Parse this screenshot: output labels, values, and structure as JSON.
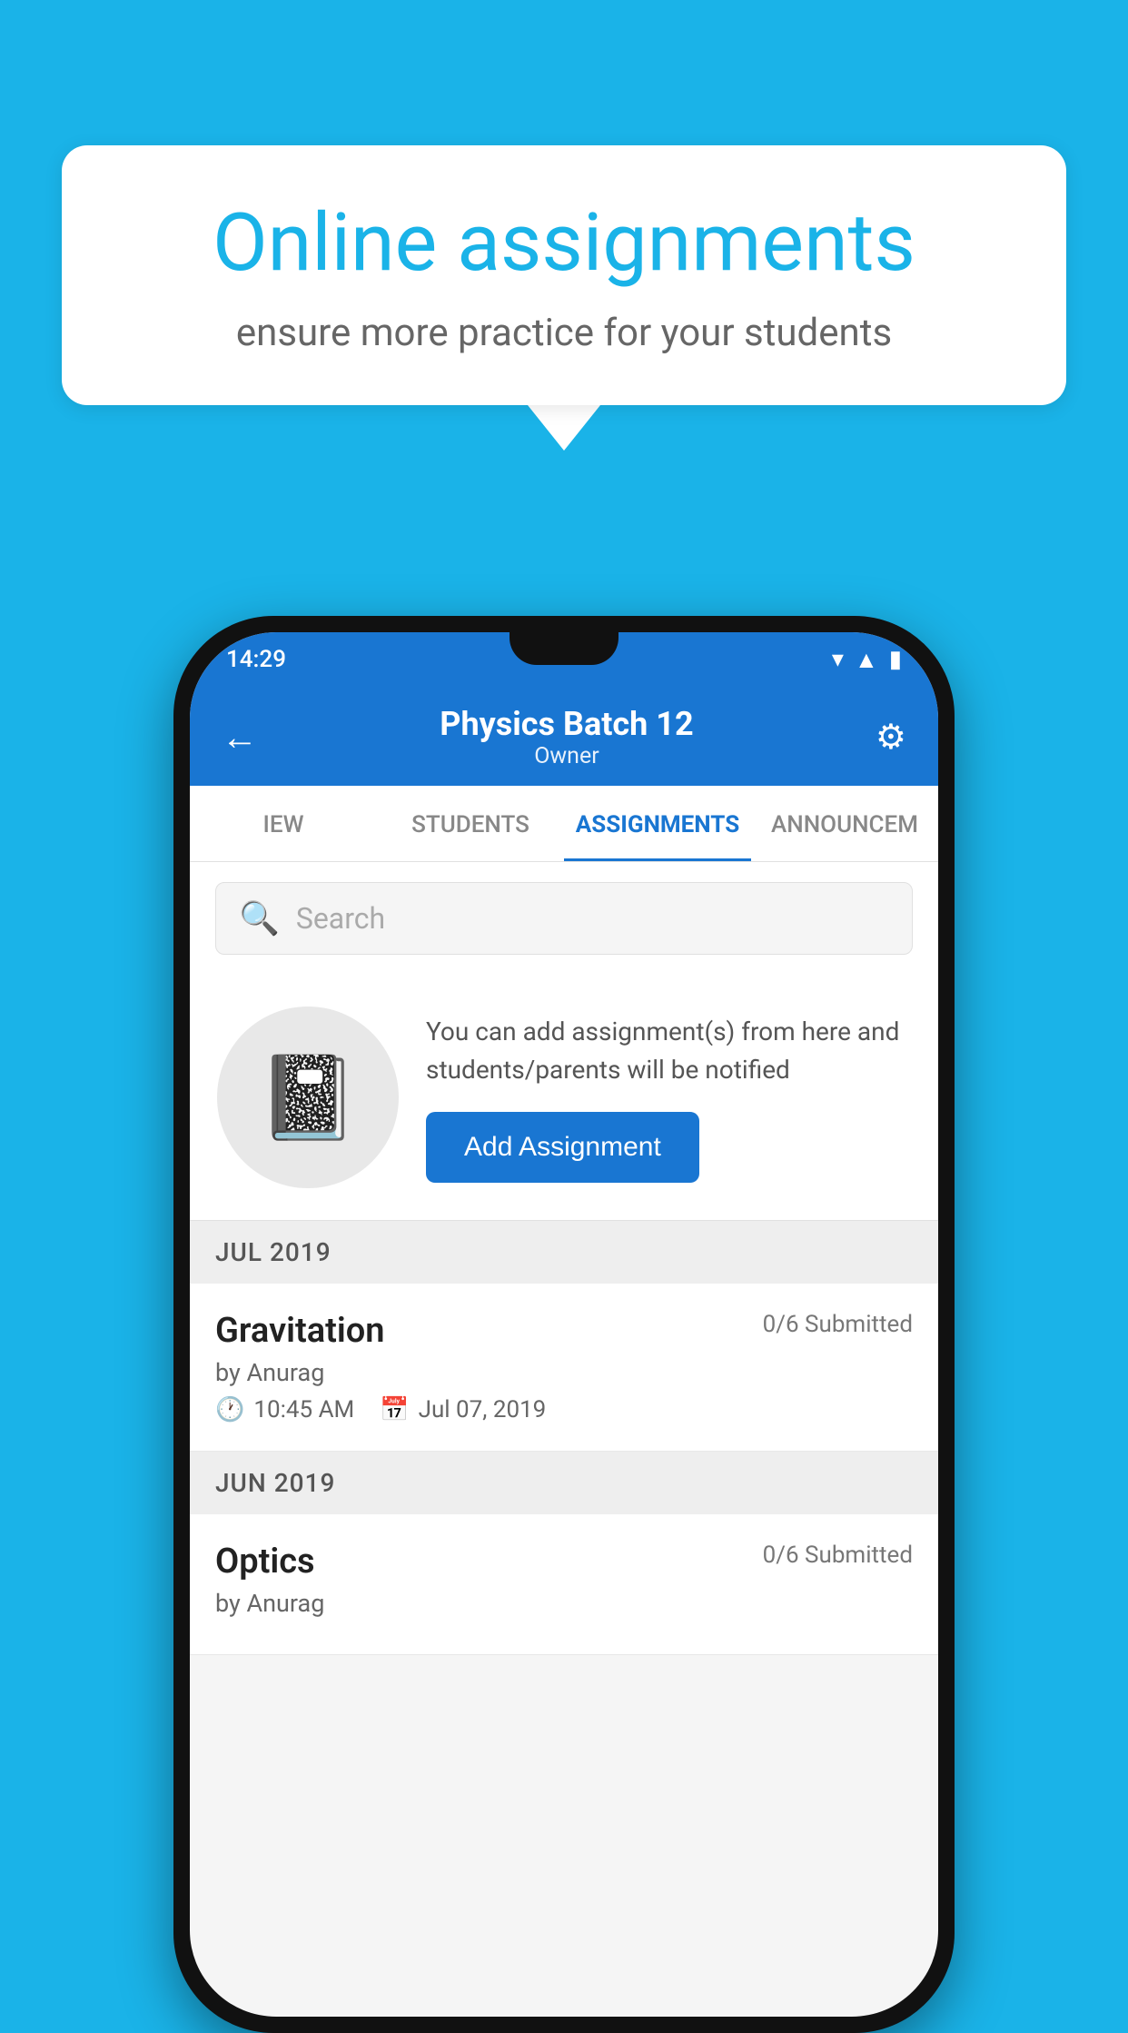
{
  "background": {
    "color": "#1ab3e8"
  },
  "speech_bubble": {
    "title": "Online assignments",
    "subtitle": "ensure more practice for your students"
  },
  "phone": {
    "status_bar": {
      "time": "14:29",
      "wifi": "wifi",
      "signal": "signal",
      "battery": "battery"
    },
    "header": {
      "back_label": "←",
      "title": "Physics Batch 12",
      "subtitle": "Owner",
      "settings_label": "⚙"
    },
    "tabs": [
      {
        "label": "IEW",
        "active": false
      },
      {
        "label": "STUDENTS",
        "active": false
      },
      {
        "label": "ASSIGNMENTS",
        "active": true
      },
      {
        "label": "ANNOUNCEM",
        "active": false
      }
    ],
    "search": {
      "placeholder": "Search"
    },
    "promo": {
      "icon": "📓",
      "description": "You can add assignment(s) from here and students/parents will be notified",
      "button_label": "Add Assignment"
    },
    "sections": [
      {
        "label": "JUL 2019",
        "assignments": [
          {
            "name": "Gravitation",
            "submitted": "0/6 Submitted",
            "by": "by Anurag",
            "time": "10:45 AM",
            "date": "Jul 07, 2019"
          }
        ]
      },
      {
        "label": "JUN 2019",
        "assignments": [
          {
            "name": "Optics",
            "submitted": "0/6 Submitted",
            "by": "by Anurag",
            "time": "",
            "date": ""
          }
        ]
      }
    ]
  }
}
